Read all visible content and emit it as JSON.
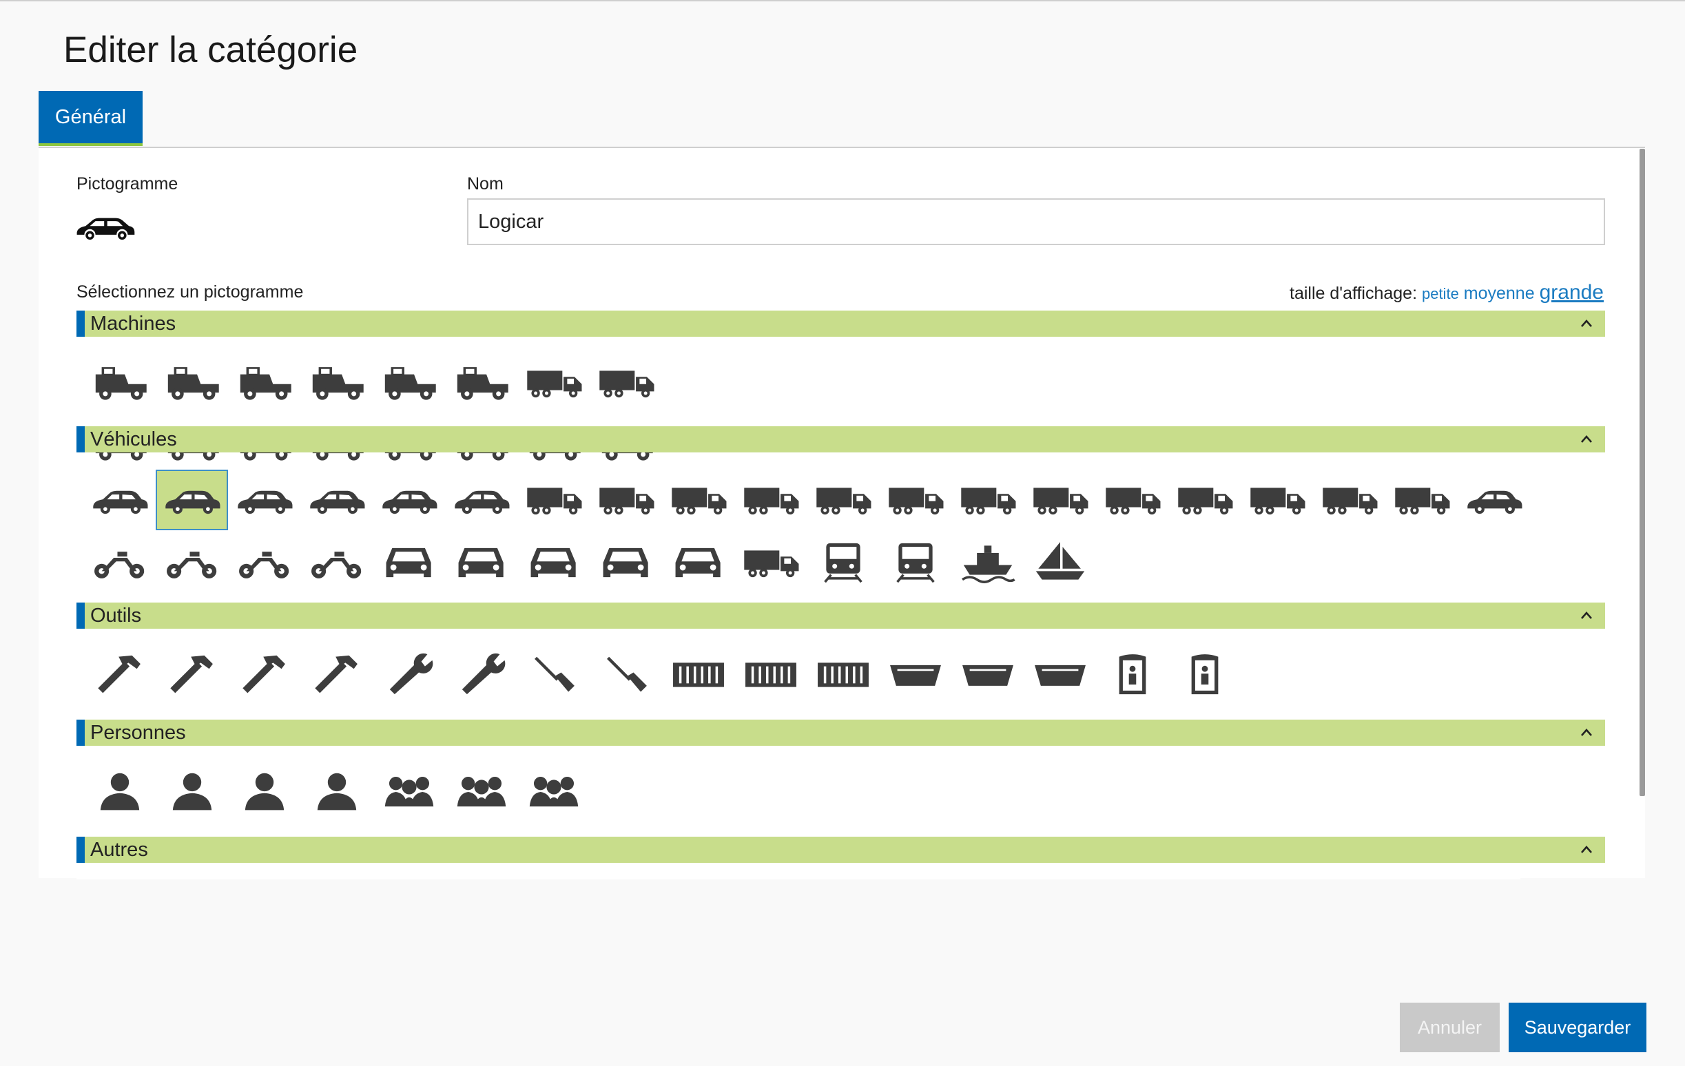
{
  "page": {
    "title": "Editer la catégorie"
  },
  "tabs": [
    {
      "label": "Général"
    }
  ],
  "form": {
    "pictogram_label": "Pictogramme",
    "current_pictogram": "car-icon",
    "name_label": "Nom",
    "name_value": "Logicar",
    "select_label": "Sélectionnez un pictogramme"
  },
  "display_size": {
    "label": "taille d'affichage:",
    "options": [
      "petite",
      "moyenne",
      "grande"
    ],
    "selected": "grande"
  },
  "sections": [
    {
      "title": "Machines",
      "icons": [
        "dumper",
        "tracked-dumper",
        "excavator",
        "tracked-excavator",
        "road-roller",
        "bulldozer",
        "wheel-loader",
        "tracked-loader",
        "compactor",
        "tandem-roller",
        "rammer",
        "plate-compactor",
        "walk-behind-roller",
        "trench-compactor",
        "paver",
        "tractor-backhoe",
        "telehandler",
        "forklift"
      ]
    },
    {
      "title": "Véhicules",
      "icons": [
        "car",
        "station-wagon",
        "taxi",
        "van",
        "minivan",
        "delivery-van",
        "crane-truck",
        "mobile-crane",
        "concrete-pump-truck",
        "tipper-truck",
        "tanker-truck",
        "flatbed-truck",
        "box-truck",
        "recovery-truck",
        "tow-truck",
        "low-loader",
        "truck-trailer",
        "tanker-trailer",
        "car-transporter",
        "ambulance",
        "wheelchair",
        "motorcycle",
        "scooter",
        "delivery-scooter",
        "small-car",
        "car-front",
        "taxi-front",
        "bus-front",
        "truck-front",
        "lorry",
        "locomotive",
        "train",
        "ferry",
        "sailboat"
      ]
    },
    {
      "title": "Outils",
      "icons": [
        "hammer-wrench",
        "hammer-wrench-crossed",
        "hammer",
        "sledgehammer",
        "wrench",
        "adjustable-wrench",
        "screwdriver",
        "screwdriver-alt",
        "container-large",
        "container-medium",
        "container-small",
        "skip",
        "skip-open",
        "skip-small",
        "portable-toilet",
        "portable-toilet-female"
      ]
    },
    {
      "title": "Personnes",
      "icons": [
        "man",
        "woman",
        "person",
        "businessman",
        "two-people",
        "three-people",
        "group"
      ]
    },
    {
      "title": "Autres",
      "icons": []
    }
  ],
  "selected_icon": "station-wagon",
  "buttons": {
    "cancel": "Annuler",
    "save": "Sauvegarder"
  },
  "colors": {
    "primary": "#0069b4",
    "section_bg": "#c8dd8b",
    "icon": "#3d3d3d",
    "link": "#1a7bc1",
    "disabled": "#c9c9c9"
  }
}
